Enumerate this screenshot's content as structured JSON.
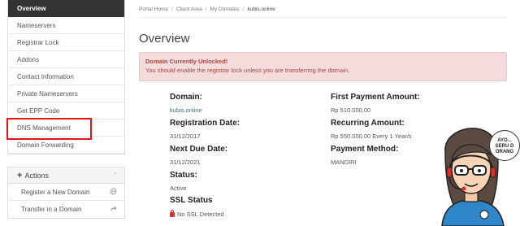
{
  "sidebar": {
    "items": [
      {
        "label": "Overview",
        "active": true
      },
      {
        "label": "Nameservers"
      },
      {
        "label": "Registrar Lock"
      },
      {
        "label": "Addons"
      },
      {
        "label": "Contact Information"
      },
      {
        "label": "Private Nameservers"
      },
      {
        "label": "Get EPP Code"
      },
      {
        "label": "DNS Management",
        "highlighted": true
      },
      {
        "label": "Domain Forwarding"
      }
    ],
    "actions": {
      "title": "Actions",
      "items": [
        {
          "label": "Register a New Domain",
          "icon": "globe-icon"
        },
        {
          "label": "Transfer in a Domain",
          "icon": "share-arrow-icon"
        }
      ]
    }
  },
  "breadcrumb": {
    "items": [
      "Portal Home",
      "Client Area",
      "My Domains",
      "kubis.online"
    ]
  },
  "main": {
    "title": "Overview",
    "alert": {
      "title": "Domain Currently Unlocked!",
      "text": "You should enable the registrar lock unless you are transferring the domain."
    },
    "left": {
      "domain_label": "Domain:",
      "domain_value": "kubis.online",
      "reg_label": "Registration Date:",
      "reg_value": "31/12/2017",
      "due_label": "Next Due Date:",
      "due_value": "31/12/2021",
      "status_label": "Status:",
      "status_value": "Active",
      "ssl_label": "SSL Status",
      "ssl_value": "No SSL Detected"
    },
    "right": {
      "first_label": "First Payment Amount:",
      "first_value": "Rp 510.000,00",
      "recurring_label": "Recurring Amount:",
      "recurring_value": "Rp 550.000,00 Every 1 Year/s",
      "method_label": "Payment Method:",
      "method_value": "MANDIRI"
    },
    "bubble_text": [
      "AYO...",
      "SERU D",
      "ORANG"
    ]
  },
  "colors": {
    "active_bg": "#333333",
    "alert_bg": "#f4dbdc",
    "alert_text": "#a94442",
    "highlight_border": "#e0151b",
    "link": "#31708f"
  }
}
